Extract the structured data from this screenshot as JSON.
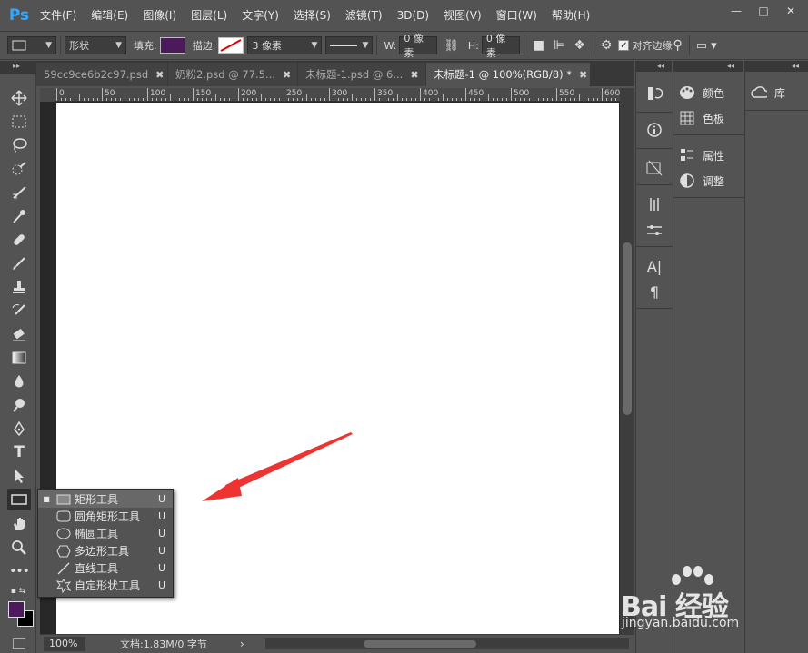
{
  "app": {
    "logo": "Ps",
    "menu": [
      "文件(F)",
      "编辑(E)",
      "图像(I)",
      "图层(L)",
      "文字(Y)",
      "选择(S)",
      "滤镜(T)",
      "3D(D)",
      "视图(V)",
      "窗口(W)",
      "帮助(H)"
    ],
    "window_controls": {
      "minimize": "—",
      "maximize": "□",
      "close": "✕"
    }
  },
  "options_bar": {
    "mode_select": "形状",
    "fill_label": "填充:",
    "fill_color": "#4a1a5c",
    "stroke_label": "描边:",
    "stroke_width": "3 像素",
    "w_label": "W:",
    "w_value": "0 像素",
    "h_label": "H:",
    "h_value": "0 像素",
    "align_edges_label": "对齐边缘"
  },
  "tabs": [
    {
      "label": "59cc9ce6b2c97.psd",
      "active": false
    },
    {
      "label": "奶粉2.psd @ 77.5...",
      "active": false
    },
    {
      "label": "未标题-1.psd @ 6...",
      "active": false
    },
    {
      "label": "未标题-1 @ 100%(RGB/8) *",
      "active": true
    }
  ],
  "ruler_h": [
    "0",
    "50",
    "100",
    "150",
    "200",
    "250",
    "300",
    "350",
    "400",
    "450",
    "500",
    "550",
    "600"
  ],
  "ruler_v": [
    "0",
    "5\n0",
    "1\n0\n0",
    "1\n5\n0",
    "2\n0\n0",
    "2\n5\n0",
    "3\n0\n0",
    "3\n5\n0",
    "4\n0\n0",
    "4\n5\n0",
    "5\n0\n0",
    "5\n5\n0"
  ],
  "status": {
    "zoom": "100%",
    "doc_info": "文档:1.83M/0 字节",
    "next_arrow": "›"
  },
  "shape_flyout": {
    "items": [
      {
        "label": "矩形工具",
        "shortcut": "U",
        "selected": true,
        "icon": "rectangle-icon"
      },
      {
        "label": "圆角矩形工具",
        "shortcut": "U",
        "selected": false,
        "icon": "rounded-rectangle-icon"
      },
      {
        "label": "椭圆工具",
        "shortcut": "U",
        "selected": false,
        "icon": "ellipse-icon"
      },
      {
        "label": "多边形工具",
        "shortcut": "U",
        "selected": false,
        "icon": "polygon-icon"
      },
      {
        "label": "直线工具",
        "shortcut": "U",
        "selected": false,
        "icon": "line-icon"
      },
      {
        "label": "自定形状工具",
        "shortcut": "U",
        "selected": false,
        "icon": "custom-shape-icon"
      }
    ]
  },
  "panels": {
    "color": "颜色",
    "swatches": "色板",
    "properties": "属性",
    "adjustments": "调整",
    "libraries": "库"
  },
  "colors": {
    "foreground": "#4a1a5c",
    "background": "#000000",
    "annotation_arrow": "#ee3333"
  },
  "watermark": {
    "brand": "Bai 经验",
    "url": "jingyan.baidu.com"
  }
}
